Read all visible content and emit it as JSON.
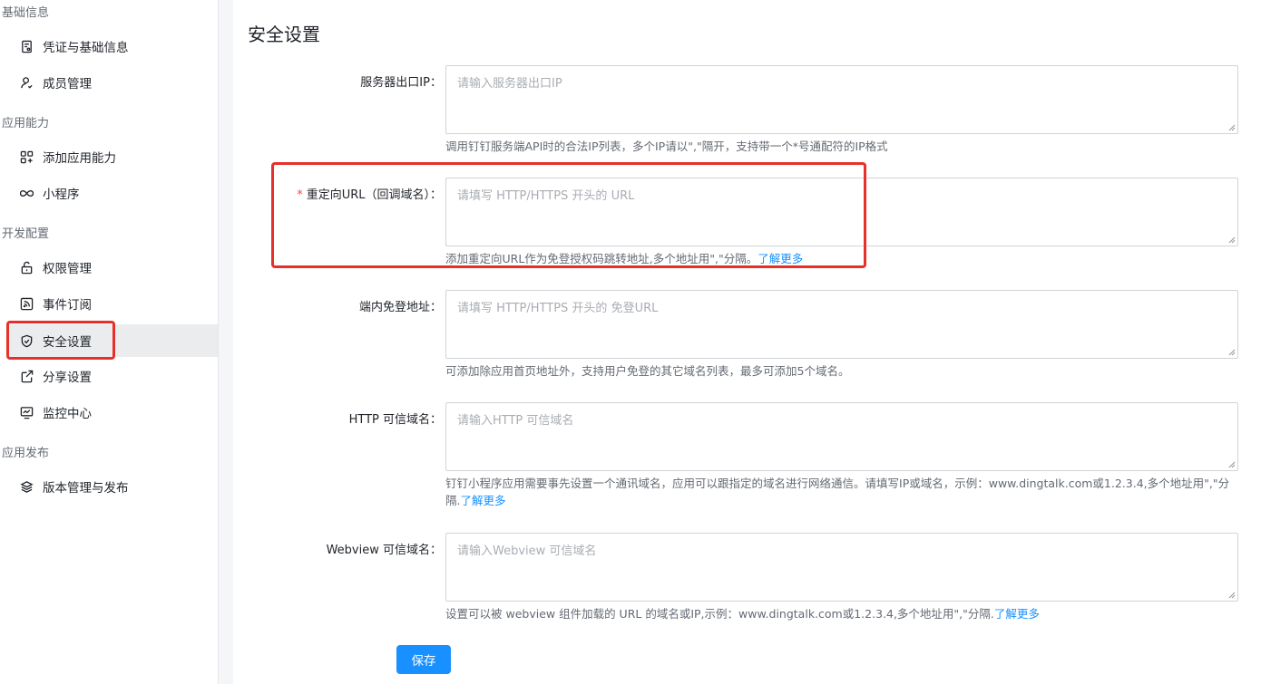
{
  "sidebar": {
    "groups": [
      {
        "title": "基础信息"
      },
      {
        "title": "应用能力"
      },
      {
        "title": "开发配置"
      },
      {
        "title": "应用发布"
      }
    ],
    "items": [
      {
        "label": "凭证与基础信息",
        "icon": "credential-icon"
      },
      {
        "label": "成员管理",
        "icon": "user-icon"
      },
      {
        "label": "添加应用能力",
        "icon": "apps-add-icon"
      },
      {
        "label": "小程序",
        "icon": "infinity-icon"
      },
      {
        "label": "权限管理",
        "icon": "lock-icon"
      },
      {
        "label": "事件订阅",
        "icon": "rss-icon"
      },
      {
        "label": "安全设置",
        "icon": "shield-icon",
        "active": true
      },
      {
        "label": "分享设置",
        "icon": "share-icon"
      },
      {
        "label": "监控中心",
        "icon": "monitor-icon"
      },
      {
        "label": "版本管理与发布",
        "icon": "layers-icon"
      }
    ]
  },
  "main": {
    "title": "安全设置",
    "fields": [
      {
        "label": "服务器出口IP",
        "placeholder": "请输入服务器出口IP",
        "help": "调用钉钉服务端API时的合法IP列表，多个IP请以\",\"隔开，支持带一个*号通配符的IP格式"
      },
      {
        "label": "重定向URL（回调域名）",
        "required": "*",
        "placeholder": "请填写 HTTP/HTTPS 开头的 URL",
        "help": "添加重定向URL作为免登授权码跳转地址,多个地址用\",\"分隔。",
        "link": "了解更多"
      },
      {
        "label": "端内免登地址",
        "placeholder": "请填写 HTTP/HTTPS 开头的 免登URL",
        "help": "可添加除应用首页地址外，支持用户免登的其它域名列表，最多可添加5个域名。"
      },
      {
        "label": "HTTP 可信域名",
        "placeholder": "请输入HTTP 可信域名",
        "help": "钉钉小程序应用需要事先设置一个通讯域名，应用可以跟指定的域名进行网络通信。请填写IP或域名，示例：www.dingtalk.com或1.2.3.4,多个地址用\",\"分隔.",
        "link": "了解更多"
      },
      {
        "label": "Webview 可信域名",
        "placeholder": "请输入Webview 可信域名",
        "help": "设置可以被 webview 组件加载的 URL 的域名或IP,示例：www.dingtalk.com或1.2.3.4,多个地址用\",\"分隔.",
        "link": "了解更多"
      }
    ],
    "colon": "：",
    "save_label": "保存"
  },
  "colors": {
    "primary": "#1890ff",
    "highlight": "#e8302a",
    "required": "#f54a45"
  }
}
